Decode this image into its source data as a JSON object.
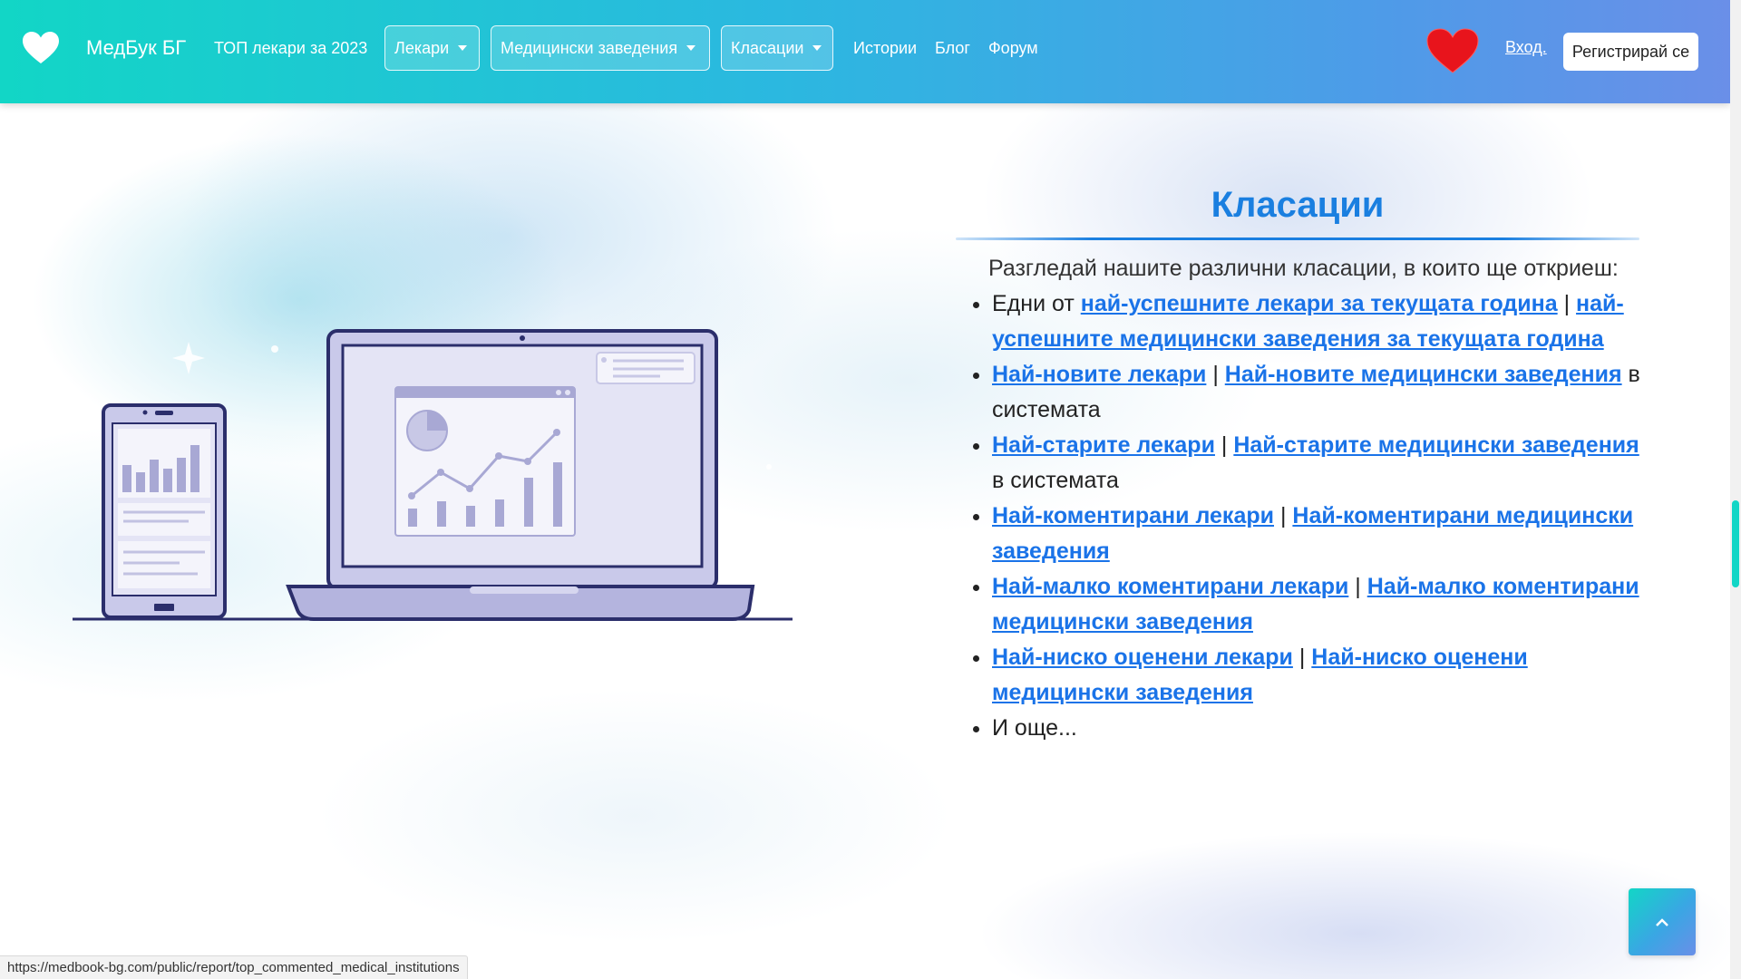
{
  "navbar": {
    "brand": "МедБук БГ",
    "top_doctors": "ТОП лекари за 2023",
    "dropdowns": [
      "Лекари",
      "Медицински заведения",
      "Класации"
    ],
    "links": [
      "Истории",
      "Блог",
      "Форум"
    ],
    "login": "Вход.",
    "register": "Регистрирай се"
  },
  "content": {
    "title": "Класации",
    "intro": "Разгледай нашите различни класации, в които ще откриеш:",
    "items": [
      {
        "prefix": "Едни от ",
        "link1": "най-успешните лекари за текущата година",
        "sep": " | ",
        "link2": "най-успешните медицински заведения за текущата година",
        "suffix": ""
      },
      {
        "prefix": "",
        "link1": "Най-новите лекари",
        "sep": " | ",
        "link2": "Най-новите медицински заведения",
        "suffix": " в системата"
      },
      {
        "prefix": "",
        "link1": "Най-старите лекари",
        "sep": " | ",
        "link2": "Най-старите медицински заведения",
        "suffix": " в системата"
      },
      {
        "prefix": "",
        "link1": "Най-коментирани лекари",
        "sep": " | ",
        "link2": "Най-коментирани медицински заведения",
        "suffix": ""
      },
      {
        "prefix": "",
        "link1": "Най-малко коментирани лекари",
        "sep": " | ",
        "link2": "Най-малко коментирани медицински заведения",
        "suffix": ""
      },
      {
        "prefix": "",
        "link1": "Най-ниско оценени лекари",
        "sep": " | ",
        "link2": "Най-ниско оценени медицински заведения",
        "suffix": ""
      },
      {
        "prefix": "И още...",
        "link1": "",
        "sep": "",
        "link2": "",
        "suffix": ""
      }
    ]
  },
  "back_to_top_icon": "chevron-up-icon",
  "status_url": "https://medbook-bg.com/public/report/top_commented_medical_institutions",
  "colors": {
    "nav_start": "#12d6c6",
    "nav_end": "#6a8fe8",
    "title": "#1a7fe0",
    "link": "#1a73e8",
    "heart": "#e8141c"
  }
}
